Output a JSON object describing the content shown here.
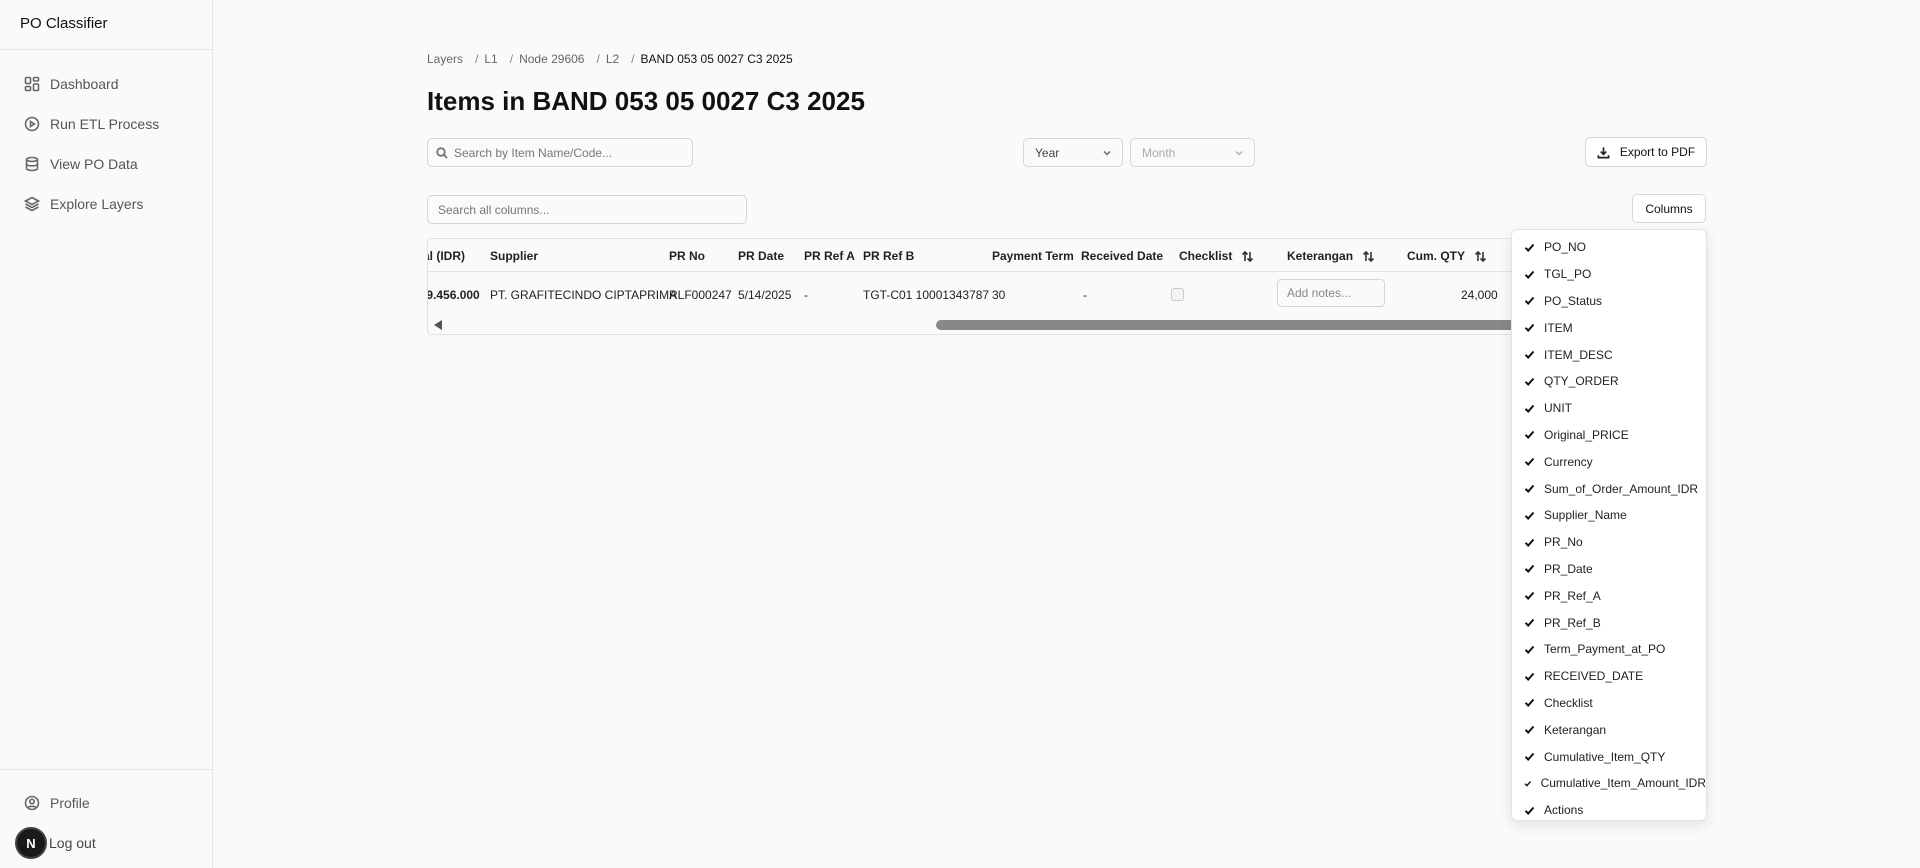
{
  "app": {
    "title": "PO Classifier"
  },
  "sidebar": {
    "items": [
      {
        "label": "Dashboard",
        "icon": "dashboard-icon"
      },
      {
        "label": "Run ETL Process",
        "icon": "play-circle-icon"
      },
      {
        "label": "View PO Data",
        "icon": "database-icon"
      },
      {
        "label": "Explore Layers",
        "icon": "layers-icon"
      }
    ],
    "bottom": {
      "profile_label": "Profile",
      "logout_label": "Log out",
      "avatar_initial": "N"
    }
  },
  "breadcrumb": {
    "items": [
      "Layers",
      "L1",
      "Node 29606",
      "L2"
    ],
    "current": "BAND 053 05 0027 C3 2025"
  },
  "page": {
    "title": "Items in BAND 053 05 0027 C3 2025"
  },
  "filters": {
    "search_placeholder": "Search by Item Name/Code...",
    "year_label": "Year",
    "month_label": "Month",
    "export_label": "Export to PDF",
    "search_all_placeholder": "Search all columns...",
    "columns_label": "Columns"
  },
  "table": {
    "headers": {
      "amount": "al (IDR)",
      "supplier": "Supplier",
      "pr_no": "PR No",
      "pr_date": "PR Date",
      "pr_ref_a": "PR Ref A",
      "pr_ref_b": "PR Ref B",
      "payment_term": "Payment Term",
      "received_date": "Received Date",
      "checklist": "Checklist",
      "keterangan": "Keterangan",
      "cum_qty": "Cum. QTY"
    },
    "row": {
      "amount": ".9.456.000",
      "supplier": "PT. GRAFITECINDO CIPTAPRIMA",
      "pr_no": "RLF000247",
      "pr_date": "5/14/2025",
      "pr_ref_a": "-",
      "pr_ref_b": "TGT-C01 10001343787",
      "payment_term": "30",
      "received_date": "-",
      "checklist": false,
      "notes_placeholder": "Add notes...",
      "cum_qty": "24,000"
    }
  },
  "columns_menu": {
    "items": [
      "PO_NO",
      "TGL_PO",
      "PO_Status",
      "ITEM",
      "ITEM_DESC",
      "QTY_ORDER",
      "UNIT",
      "Original_PRICE",
      "Currency",
      "Sum_of_Order_Amount_IDR",
      "Supplier_Name",
      "PR_No",
      "PR_Date",
      "PR_Ref_A",
      "PR_Ref_B",
      "Term_Payment_at_PO",
      "RECEIVED_DATE",
      "Checklist",
      "Keterangan",
      "Cumulative_Item_QTY",
      "Cumulative_Item_Amount_IDR",
      "Actions"
    ]
  }
}
